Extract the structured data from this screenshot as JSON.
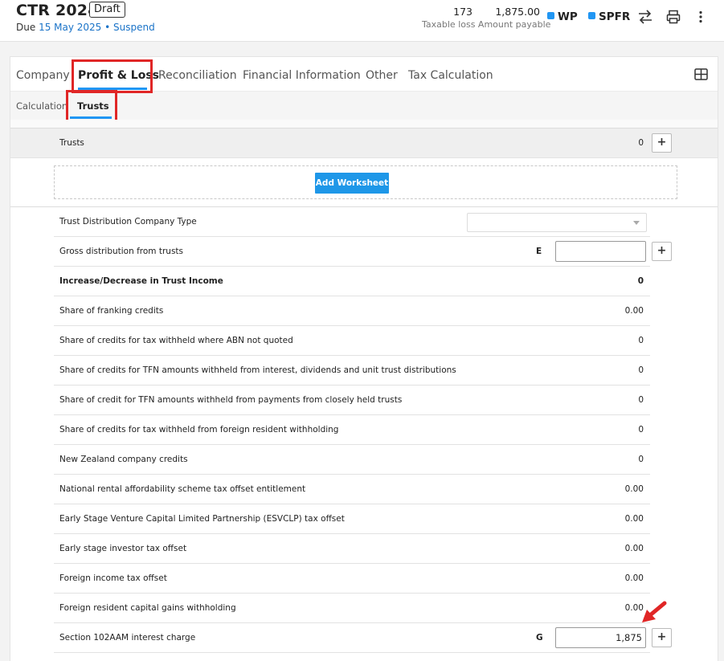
{
  "header": {
    "title": "CTR 2024",
    "badge": "Draft",
    "due_prefix": "Due",
    "due_date": "15 May 2025",
    "separator": "•",
    "suspend": "Suspend",
    "taxable_loss_value": "173",
    "amount_payable_value": "1,875.00",
    "metric_labels": "Taxable loss Amount payable",
    "wp": "WP",
    "spfr": "SPFR",
    "accent": "#2196f3",
    "icons": [
      "swap-icon",
      "print-icon",
      "more-vertical-icon"
    ]
  },
  "tabs": [
    "Company",
    "Profit & Loss",
    "Reconciliation",
    "Financial Information",
    "Other",
    "Tax Calculation"
  ],
  "active_tab": "Profit & Loss",
  "subtabs": [
    "Calculation",
    "Trusts"
  ],
  "active_subtab": "Trusts",
  "trusts": {
    "label": "Trusts",
    "count": "0",
    "add_worksheet": "Add Worksheet"
  },
  "rows": {
    "type": {
      "label": "Trust Distribution Company Type",
      "value": ""
    },
    "gross": {
      "label": "Gross distribution from trusts",
      "code": "E",
      "value": ""
    },
    "increase": {
      "label": "Increase/Decrease in Trust Income",
      "value": "0"
    },
    "franking": {
      "label": "Share of franking credits",
      "value": "0.00"
    },
    "abn": {
      "label": "Share of credits for tax withheld where ABN not quoted",
      "value": "0"
    },
    "tfn_interest": {
      "label": "Share of credits for TFN amounts withheld from interest, dividends and unit trust distributions",
      "value": "0"
    },
    "tfn_closely": {
      "label": "Share of credit for TFN amounts withheld from payments from closely held trusts",
      "value": "0"
    },
    "foreign_withholding": {
      "label": "Share of credits for tax withheld from foreign resident withholding",
      "value": "0"
    },
    "nz": {
      "label": "New Zealand company credits",
      "value": "0"
    },
    "nras": {
      "label": "National rental affordability scheme tax offset entitlement",
      "value": "0.00"
    },
    "esvclp": {
      "label": "Early Stage Venture Capital Limited Partnership (ESVCLP) tax offset",
      "value": "0.00"
    },
    "esi": {
      "label": "Early stage investor tax offset",
      "value": "0.00"
    },
    "fito": {
      "label": "Foreign income tax offset",
      "value": "0.00"
    },
    "frcgw": {
      "label": "Foreign resident capital gains withholding",
      "value": "0.00"
    },
    "s102aam": {
      "label": "Section 102AAM interest charge",
      "code": "G",
      "value": "1,875"
    }
  },
  "plus_symbol": "+",
  "highlight_color": "#e02626"
}
